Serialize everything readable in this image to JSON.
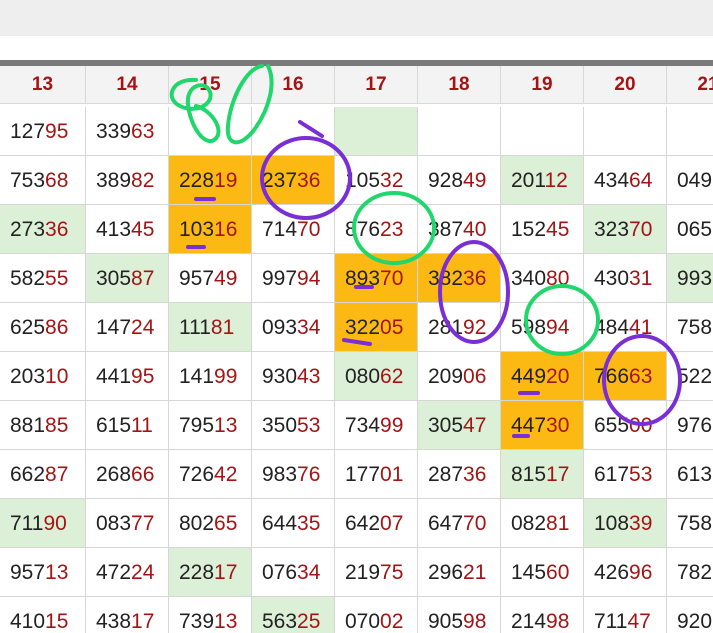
{
  "columns": [
    "13",
    "14",
    "15",
    "16",
    "17",
    "18",
    "19",
    "20",
    "21"
  ],
  "rows": [
    [
      "12795",
      "33963",
      "",
      "",
      "",
      "",
      "",
      "",
      ""
    ],
    [
      "75368",
      "38982",
      "22819",
      "23736",
      "10532",
      "92849",
      "20112",
      "43464",
      "049"
    ],
    [
      "27336",
      "41345",
      "10316",
      "71470",
      "87623",
      "38740",
      "15245",
      "32370",
      "065"
    ],
    [
      "58255",
      "30587",
      "95749",
      "99794",
      "89370",
      "38236",
      "34080",
      "43031",
      "993"
    ],
    [
      "62586",
      "14724",
      "11181",
      "09334",
      "32205",
      "28192",
      "59894",
      "48441",
      "758"
    ],
    [
      "20310",
      "44195",
      "14199",
      "93043",
      "08062",
      "20906",
      "44920",
      "76663",
      "522"
    ],
    [
      "88185",
      "61511",
      "79513",
      "35053",
      "73499",
      "30547",
      "44730",
      "65500",
      "976"
    ],
    [
      "66287",
      "26866",
      "72642",
      "98376",
      "17701",
      "28736",
      "81517",
      "61753",
      "613"
    ],
    [
      "71190",
      "08377",
      "80265",
      "64435",
      "64207",
      "64770",
      "08281",
      "10839",
      "758"
    ],
    [
      "95713",
      "47224",
      "22817",
      "07634",
      "21975",
      "29621",
      "14560",
      "42696",
      "782"
    ],
    [
      "41015",
      "43817",
      "73913",
      "56325",
      "07002",
      "90598",
      "21498",
      "71147",
      "920"
    ]
  ],
  "highlights": {
    "green": [
      [
        0,
        4
      ],
      [
        1,
        6
      ],
      [
        2,
        0
      ],
      [
        2,
        7
      ],
      [
        3,
        1
      ],
      [
        3,
        8
      ],
      [
        4,
        2
      ],
      [
        5,
        4
      ],
      [
        6,
        5
      ],
      [
        7,
        6
      ],
      [
        8,
        0
      ],
      [
        8,
        7
      ],
      [
        9,
        2
      ],
      [
        10,
        3
      ]
    ],
    "orange": [
      [
        1,
        2
      ],
      [
        1,
        3
      ],
      [
        2,
        2
      ],
      [
        3,
        4
      ],
      [
        3,
        5
      ],
      [
        4,
        4
      ],
      [
        5,
        6
      ],
      [
        5,
        7
      ],
      [
        6,
        6
      ]
    ]
  },
  "colors": {
    "green_cell": "#dcefd7",
    "orange_cell": "#fdb913",
    "header_text": "#a31515",
    "digit_dark": "#222222",
    "digit_red": "#a31515",
    "ink_green": "#21d66b",
    "ink_purple": "#7a2ed6"
  }
}
